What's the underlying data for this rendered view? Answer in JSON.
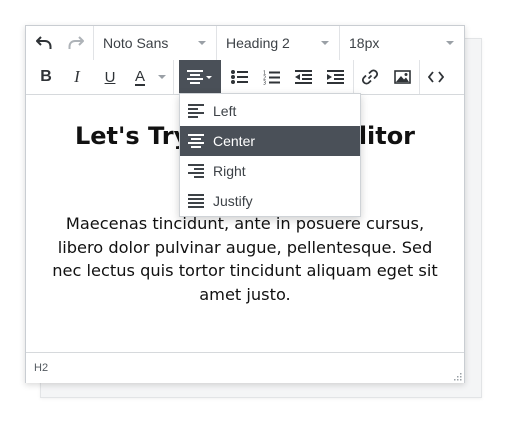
{
  "toolbar": {
    "font_family": "Noto Sans",
    "format": "Heading 2",
    "font_size": "18px",
    "buttons": {
      "undo": "undo-icon",
      "redo": "redo-icon",
      "bold": "B",
      "italic": "I",
      "underline": "U",
      "font_color": "A",
      "align": "align-center-icon",
      "bullet_list": "bullet-list-icon",
      "numbered_list": "numbered-list-icon",
      "outdent": "outdent-icon",
      "indent": "indent-icon",
      "link": "link-icon",
      "image": "image-icon",
      "source_code": "code-icon"
    }
  },
  "align_menu": {
    "items": [
      {
        "label": "Left",
        "icon": "align-left-icon"
      },
      {
        "label": "Center",
        "icon": "align-center-icon"
      },
      {
        "label": "Right",
        "icon": "align-right-icon"
      },
      {
        "label": "Justify",
        "icon": "align-justify-icon"
      }
    ],
    "selected": "Center"
  },
  "content": {
    "heading": "Let's Try Your New Editor",
    "paragraph": "Maecenas tincidunt, ante in posuere cursus, libero dolor pulvinar augue, pellentesque. Sed nec lectus quis tortor tincidunt aliquam eget sit amet justo."
  },
  "statusbar": {
    "path": "H2"
  },
  "colors": {
    "selected_bg": "#4a5058",
    "border": "#c9cdd2"
  }
}
